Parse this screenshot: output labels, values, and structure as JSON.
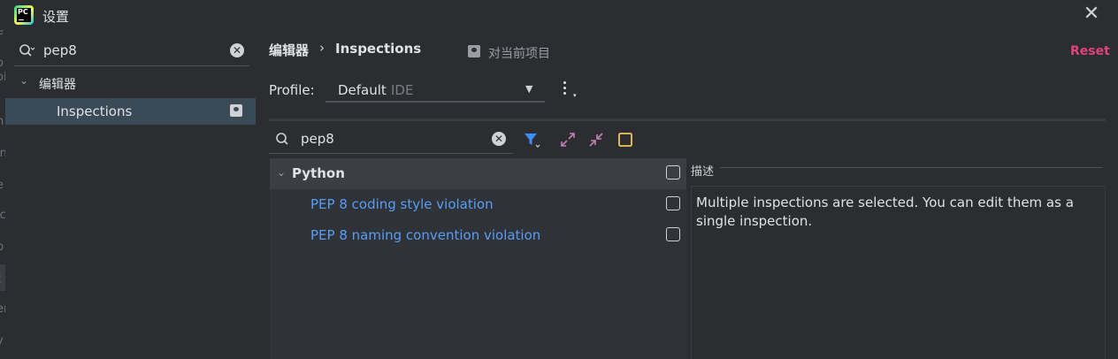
{
  "window": {
    "title": "设置"
  },
  "left_panel": {
    "search": {
      "value": "pep8"
    },
    "tree": {
      "group_label": "编辑器",
      "selected_item": "Inspections"
    },
    "edge_fragments": [
      "e",
      "o",
      "oi",
      "n",
      "in",
      "e",
      "ic",
      "p",
      "t",
      "er",
      "y"
    ]
  },
  "header": {
    "breadcrumb": [
      "编辑器",
      "Inspections"
    ],
    "breadcrumb_separator": "›",
    "project_scope_label": "对当前项目",
    "reset_label": "Reset"
  },
  "profile": {
    "label": "Profile:",
    "value": "Default",
    "scope": "IDE"
  },
  "inspections": {
    "search": {
      "value": "pep8"
    },
    "toolbar_icons": [
      "filter-icon",
      "expand-all-icon",
      "collapse-all-icon",
      "reset-to-default-icon"
    ],
    "group": {
      "label": "Python",
      "checked": false
    },
    "items": [
      {
        "label": "PEP 8 coding style violation",
        "checked": false
      },
      {
        "label": "PEP 8 naming convention violation",
        "checked": false
      }
    ]
  },
  "description": {
    "title": "描述",
    "text": "Multiple inspections are selected. You can edit them as a single inspection."
  },
  "colors": {
    "background": "#2b2d30",
    "selection": "#3a4a56",
    "link": "#589df6",
    "reset": "#e0447a",
    "filter": "#3d8ef8",
    "expand": "#c77dbb",
    "highlight": "#f2c55c"
  }
}
